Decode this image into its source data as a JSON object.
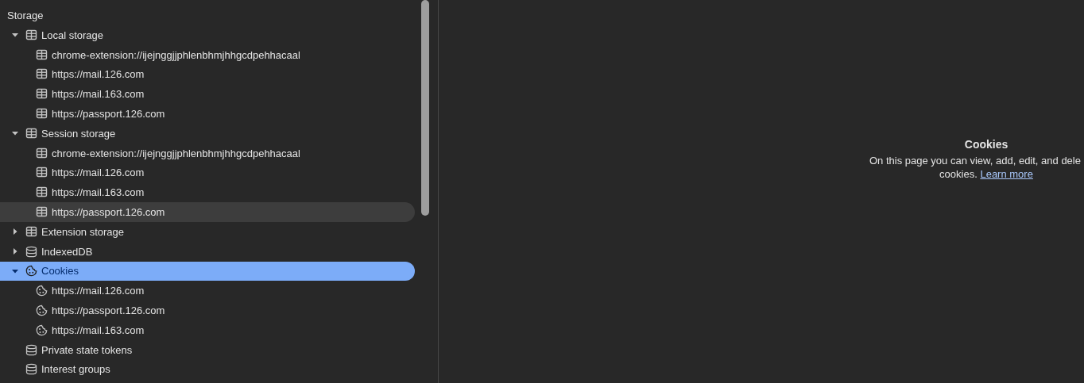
{
  "sidebar": {
    "heading": "Storage",
    "items": [
      {
        "label": "Local storage",
        "kind": "table",
        "expanded": true,
        "selected": false,
        "hovered": false,
        "children": [
          {
            "label": "chrome-extension://ijejnggjjphlenbhmjhhgcdpehhacaal",
            "kind": "table",
            "selected": false,
            "hovered": false
          },
          {
            "label": "https://mail.126.com",
            "kind": "table",
            "selected": false,
            "hovered": false
          },
          {
            "label": "https://mail.163.com",
            "kind": "table",
            "selected": false,
            "hovered": false
          },
          {
            "label": "https://passport.126.com",
            "kind": "table",
            "selected": false,
            "hovered": false
          }
        ]
      },
      {
        "label": "Session storage",
        "kind": "table",
        "expanded": true,
        "selected": false,
        "hovered": false,
        "children": [
          {
            "label": "chrome-extension://ijejnggjjphlenbhmjhhgcdpehhacaal",
            "kind": "table",
            "selected": false,
            "hovered": false
          },
          {
            "label": "https://mail.126.com",
            "kind": "table",
            "selected": false,
            "hovered": false
          },
          {
            "label": "https://mail.163.com",
            "kind": "table",
            "selected": false,
            "hovered": false
          },
          {
            "label": "https://passport.126.com",
            "kind": "table",
            "selected": false,
            "hovered": true
          }
        ]
      },
      {
        "label": "Extension storage",
        "kind": "table",
        "expanded": false,
        "selected": false,
        "hovered": false
      },
      {
        "label": "IndexedDB",
        "kind": "database",
        "expanded": false,
        "selected": false,
        "hovered": false
      },
      {
        "label": "Cookies",
        "kind": "cookie",
        "expanded": true,
        "selected": true,
        "hovered": false,
        "children": [
          {
            "label": "https://mail.126.com",
            "kind": "cookie",
            "selected": false,
            "hovered": false
          },
          {
            "label": "https://passport.126.com",
            "kind": "cookie",
            "selected": false,
            "hovered": false
          },
          {
            "label": "https://mail.163.com",
            "kind": "cookie",
            "selected": false,
            "hovered": false
          }
        ]
      },
      {
        "label": "Private state tokens",
        "kind": "database",
        "selected": false,
        "hovered": false
      },
      {
        "label": "Interest groups",
        "kind": "database",
        "selected": false,
        "hovered": false
      }
    ]
  },
  "empty_state": {
    "title": "Cookies",
    "message_line_1": "On this page you can view, add, edit, and dele",
    "message_line_2": "cookies.",
    "link": "Learn more"
  }
}
